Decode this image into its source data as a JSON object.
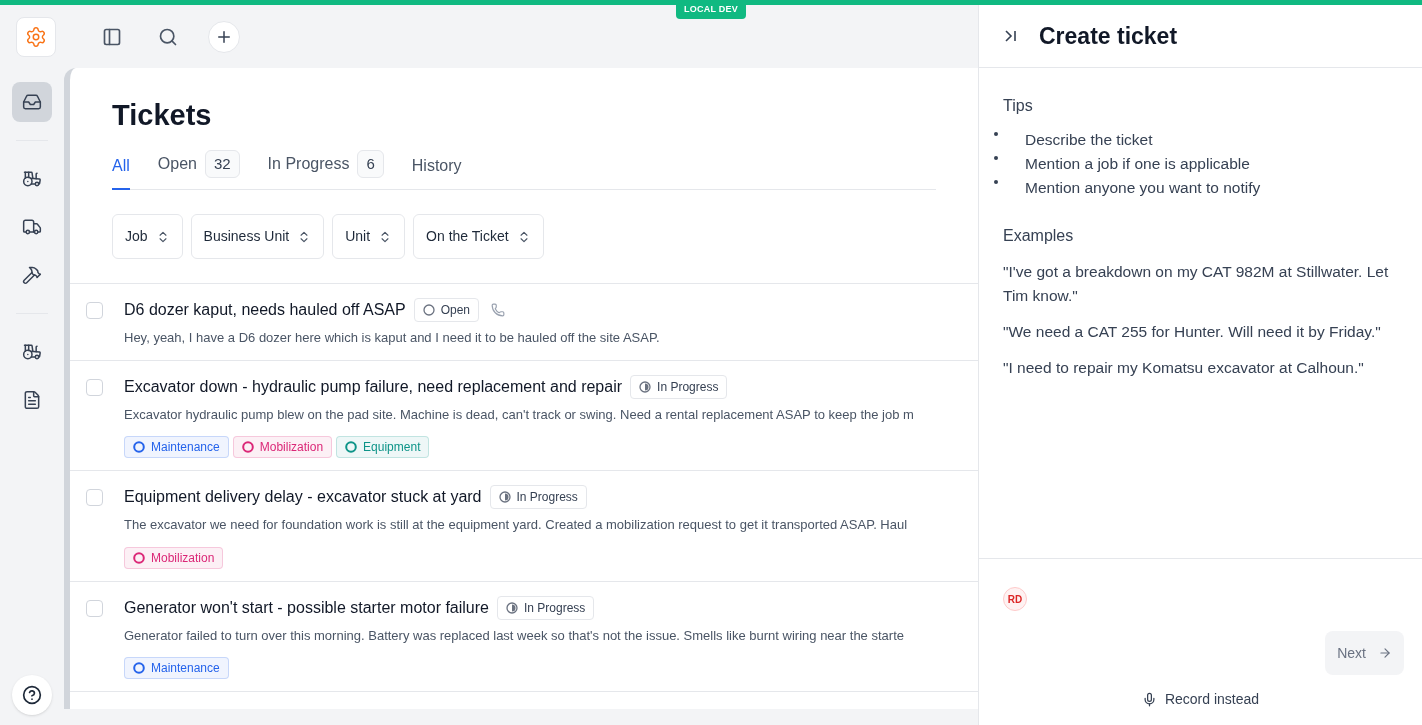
{
  "env_badge": "LOCAL DEV",
  "rail": {
    "items": [
      {
        "selected": true
      },
      {
        "selected": false
      },
      {
        "selected": false
      },
      {
        "selected": false
      },
      {
        "selected": false
      },
      {
        "selected": false
      }
    ]
  },
  "page": {
    "title": "Tickets",
    "tabs": [
      {
        "label": "All",
        "selected": true
      },
      {
        "label": "Open",
        "count": "32",
        "selected": false
      },
      {
        "label": "In Progress",
        "count": "6",
        "selected": false
      },
      {
        "label": "History",
        "selected": false
      }
    ],
    "filters": [
      "Job",
      "Business Unit",
      "Unit",
      "On the Ticket"
    ],
    "tickets": [
      {
        "title": "D6 dozer kaput, needs hauled off ASAP",
        "status": {
          "kind": "open",
          "label": "Open"
        },
        "phone": true,
        "checked": false,
        "description": "Hey, yeah, I have a D6 dozer here which is kaput and I need it to be hauled off the site ASAP."
      },
      {
        "title": "Excavator down - hydraulic pump failure, need replacement and repair",
        "status": {
          "kind": "in_progress",
          "label": "In Progress"
        },
        "checked": false,
        "description": "Excavator hydraulic pump blew on the pad site. Machine is dead, can't track or swing. Need a rental replacement ASAP to keep the job m",
        "tags": [
          {
            "label": "Maintenance",
            "color": "#2563eb"
          },
          {
            "label": "Mobilization",
            "color": "#db2777"
          },
          {
            "label": "Equipment",
            "color": "#0d9488"
          }
        ]
      },
      {
        "title": "Equipment delivery delay - excavator stuck at yard",
        "status": {
          "kind": "in_progress",
          "label": "In Progress"
        },
        "checked": false,
        "description": "The excavator we need for foundation work is still at the equipment yard. Created a mobilization request to get it transported ASAP. Haul",
        "tags": [
          {
            "label": "Mobilization",
            "color": "#db2777"
          }
        ]
      },
      {
        "title": "Generator won't start - possible starter motor failure",
        "status": {
          "kind": "in_progress",
          "label": "In Progress"
        },
        "checked": false,
        "description": "Generator failed to turn over this morning. Battery was replaced last week so that's not the issue. Smells like burnt wiring near the starte",
        "tags": [
          {
            "label": "Maintenance",
            "color": "#2563eb"
          }
        ]
      }
    ]
  },
  "panel": {
    "title": "Create ticket",
    "tips_heading": "Tips",
    "tips": [
      "Describe the ticket",
      "Mention a job if one is applicable",
      "Mention anyone you want to notify"
    ],
    "examples_heading": "Examples",
    "examples": [
      "\"I've got a breakdown on my CAT 982M at Stillwater. Let Tim know.\"",
      "\"We need a CAT 255 for Hunter. Will need it by Friday.\"",
      "\"I need to repair my Komatsu excavator at Calhoun.\""
    ],
    "avatar": "RD",
    "next_button": {
      "label": "Next",
      "disabled": true
    },
    "record_button": "Record instead"
  }
}
